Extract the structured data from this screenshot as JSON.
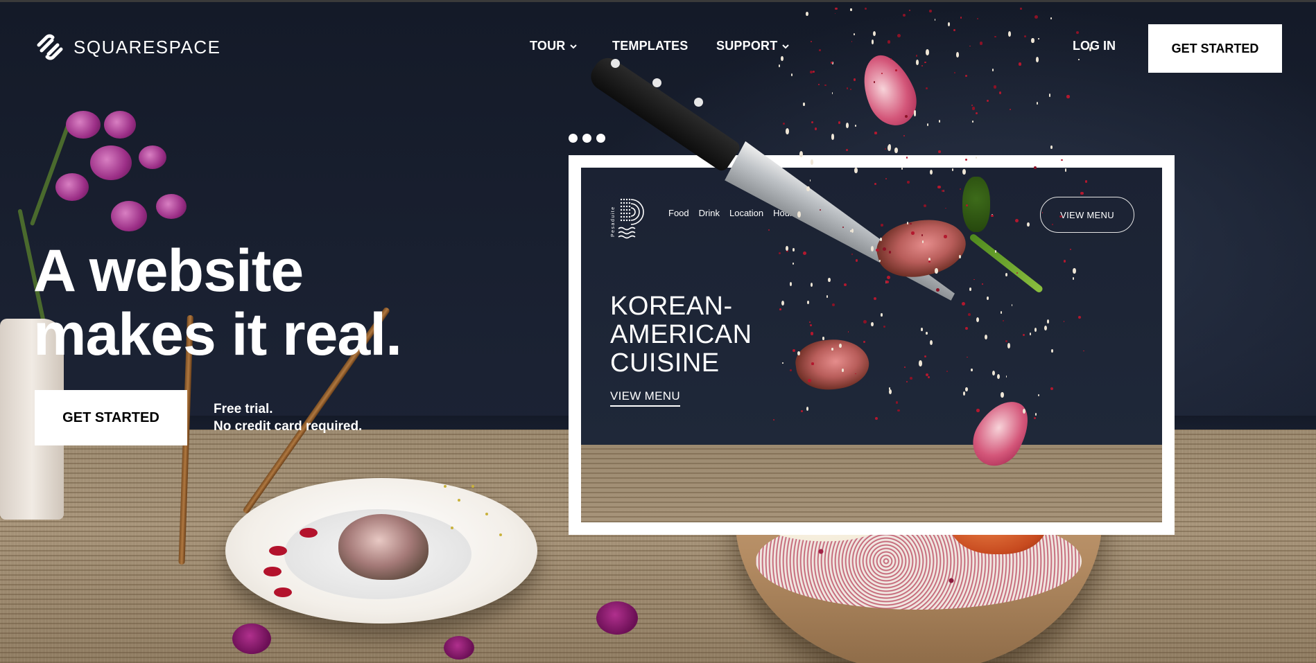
{
  "brand": {
    "name": "SQUARESPACE"
  },
  "nav": {
    "tour": "TOUR",
    "templates": "TEMPLATES",
    "support": "SUPPORT",
    "login": "LOG IN",
    "get_started": "GET STARTED"
  },
  "hero": {
    "title_line1": "A website",
    "title_line2": "makes it real.",
    "cta": "GET STARTED",
    "trial_line1": "Free trial.",
    "trial_line2": "No credit card required."
  },
  "preview": {
    "site_name": "Pesaduite",
    "nav_items": [
      "Food",
      "Drink",
      "Location",
      "Hours"
    ],
    "view_menu_button": "VIEW MENU",
    "headline_lines": [
      "KOREAN-",
      "AMERICAN",
      "CUISINE"
    ],
    "view_menu_link": "VIEW MENU"
  },
  "icons": {
    "logo": "squarespace-logo-icon",
    "chevron": "chevron-down-icon",
    "window_dots": "window-dots-icon"
  },
  "colors": {
    "backdrop": "#1b2233",
    "button_bg": "#ffffff",
    "button_text": "#000000",
    "text": "#ffffff"
  }
}
